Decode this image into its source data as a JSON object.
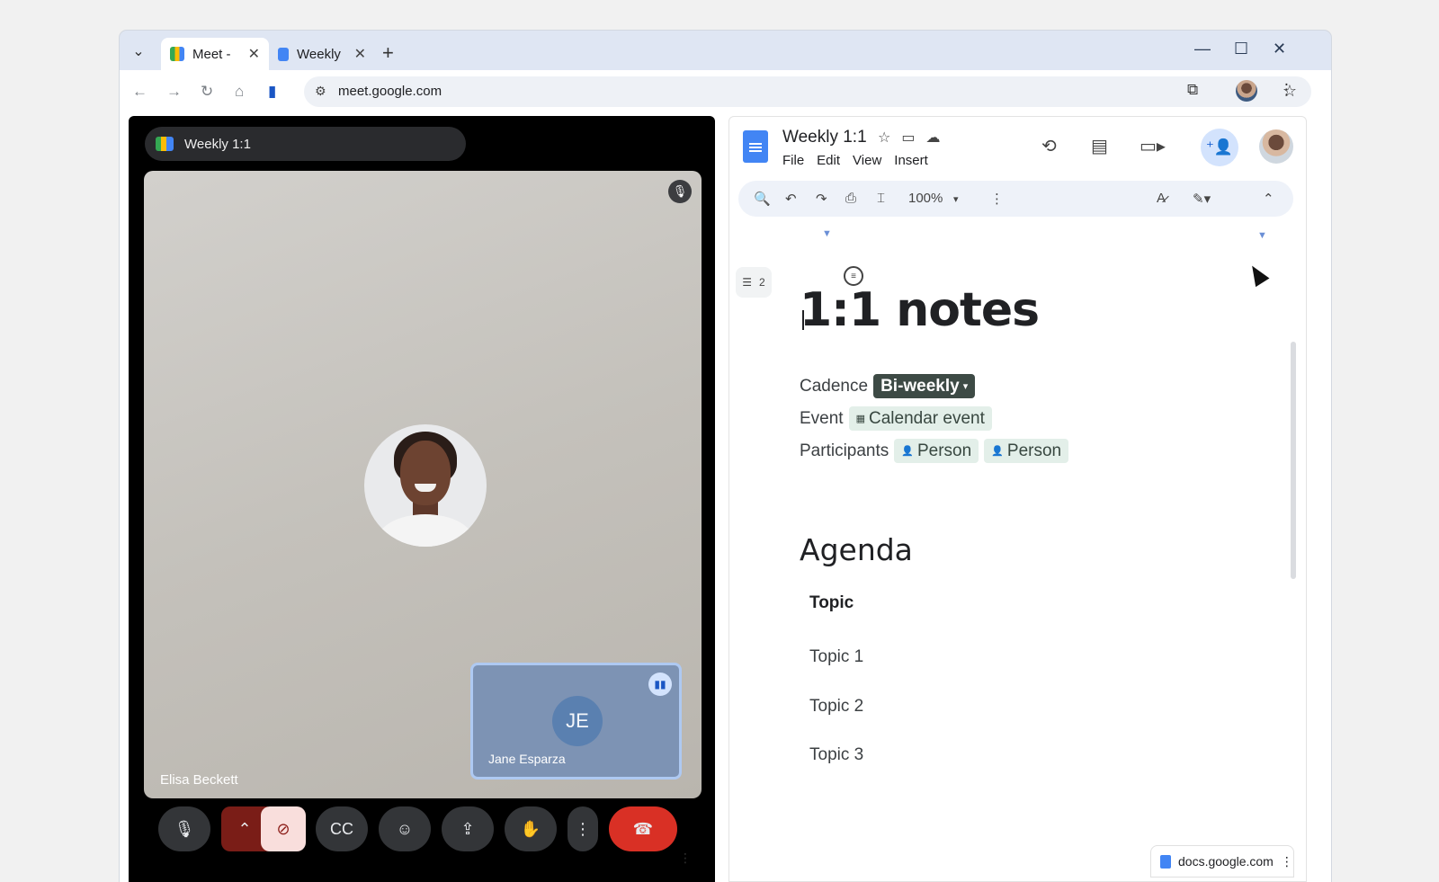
{
  "browser": {
    "tabs": [
      {
        "label": "Meet -",
        "active": true
      },
      {
        "label": "Weekly",
        "active": false
      }
    ],
    "url": "meet.google.com",
    "icons": [
      "tab-list-icon",
      "close-icon",
      "new-tab-icon",
      "minimize-icon",
      "maximize-icon",
      "window-close-icon",
      "back-icon",
      "forward-icon",
      "reload-icon",
      "home-icon",
      "side-panel-icon",
      "site-info-icon",
      "bookmark-star-icon",
      "extensions-icon",
      "menu-icon"
    ]
  },
  "meet": {
    "title": "Weekly 1:1",
    "main_participant": "Elisa Beckett",
    "self_participant": {
      "name": "Jane Esparza",
      "initials": "JE"
    },
    "accent_end_call": "#d93025"
  },
  "docs": {
    "title": "Weekly 1:1",
    "menus": [
      "File",
      "Edit",
      "View",
      "Insert"
    ],
    "zoom": "100%",
    "outline_count": "2",
    "heading": "1:1 notes",
    "properties": {
      "cadence_label": "Cadence",
      "cadence_value": "Bi-weekly",
      "event_label": "Event",
      "event_value": "Calendar event",
      "participants_label": "Participants",
      "participant_1": "Person",
      "participant_2": "Person"
    },
    "agenda_heading": "Agenda",
    "topics_header": "Topic",
    "topics": [
      "Topic 1",
      "Topic 2",
      "Topic 3"
    ],
    "side_chip": "docs.google.com"
  }
}
